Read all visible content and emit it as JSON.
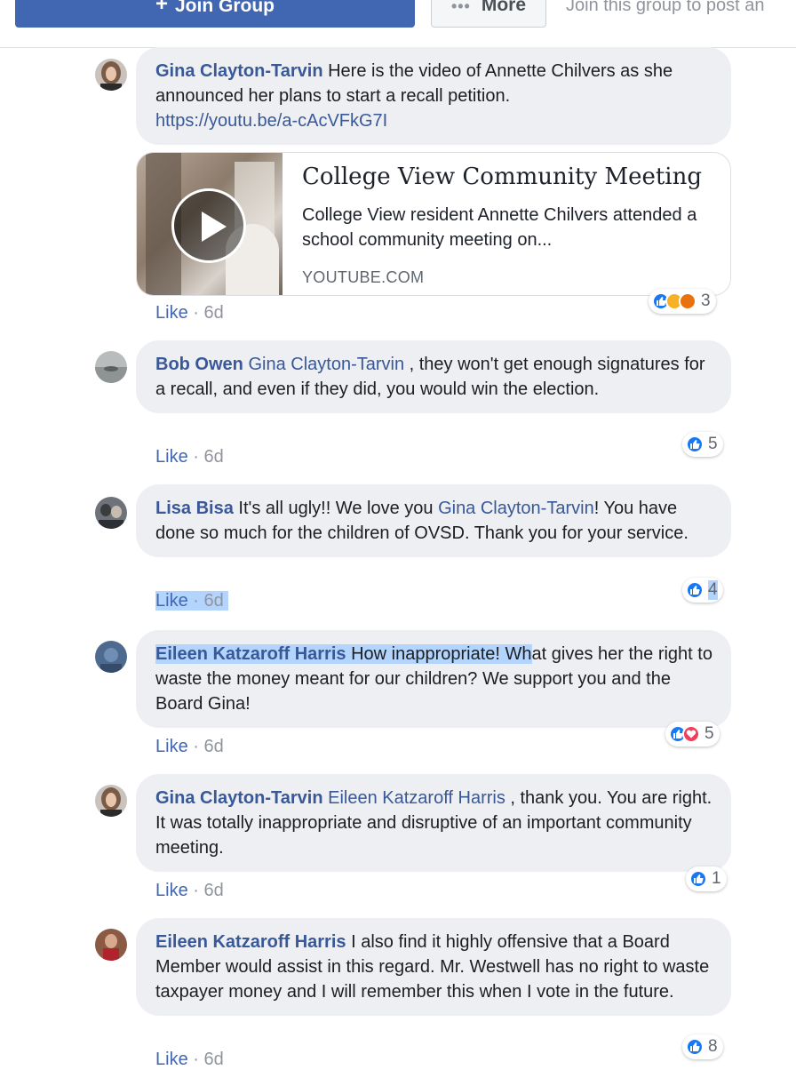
{
  "topbar": {
    "join_label": "Join Group",
    "more_label": "More",
    "join_note": "Join this group to post an"
  },
  "comments": [
    {
      "author": "Gina Clayton-Tarvin",
      "text": "Here is the video of Annette Chilvers as she announced her plans to start a recall petition.",
      "link": "https://youtu.be/a-cAcVFkG7I",
      "preview": {
        "title": "College View Community Meeting",
        "description": "College View resident Annette Chilvers attended a school community meeting on...",
        "domain": "YOUTUBE.COM"
      },
      "like": "Like",
      "time": "6d",
      "reaction_count": "3"
    },
    {
      "author": "Bob Owen",
      "mention": "Gina Clayton-Tarvin",
      "text": ", they won't get enough signatures for a recall, and even if they did, you would win the election.",
      "like": "Like",
      "time": "6d",
      "reaction_count": "5"
    },
    {
      "author": "Lisa Bisa",
      "text_before": "It's all ugly!! We love you",
      "mention": "Gina Clayton-Tarvin",
      "text_after": "! You have done so much for the children of OVSD. Thank you for your service.",
      "like": "Like",
      "time": "6d",
      "reaction_count": "4"
    },
    {
      "author": "Eileen Katzaroff Harris",
      "text_highlight": "How inappropriate! Wh",
      "text": "at gives her the right to waste the money meant for our children? We support you and the Board Gina!",
      "like": "Like",
      "time": "6d",
      "reaction_count": "5"
    },
    {
      "author": "Gina Clayton-Tarvin",
      "mention": "Eileen Katzaroff Harris",
      "text": ", thank you. You are right. It was totally inappropriate and disruptive of an important community meeting.",
      "like": "Like",
      "time": "6d",
      "reaction_count": "1"
    },
    {
      "author": "Eileen Katzaroff Harris",
      "text": "I also find it highly offensive that a Board Member would assist in this regard. Mr. Westwell has no right to waste taxpayer money and I will remember this when I vote in the future.",
      "like": "Like",
      "time": "6d",
      "reaction_count": "8"
    }
  ],
  "colors": {
    "brand": "#4267b2",
    "link": "#385898",
    "bubble": "#edeff2",
    "highlight": "#b3d4fc"
  }
}
